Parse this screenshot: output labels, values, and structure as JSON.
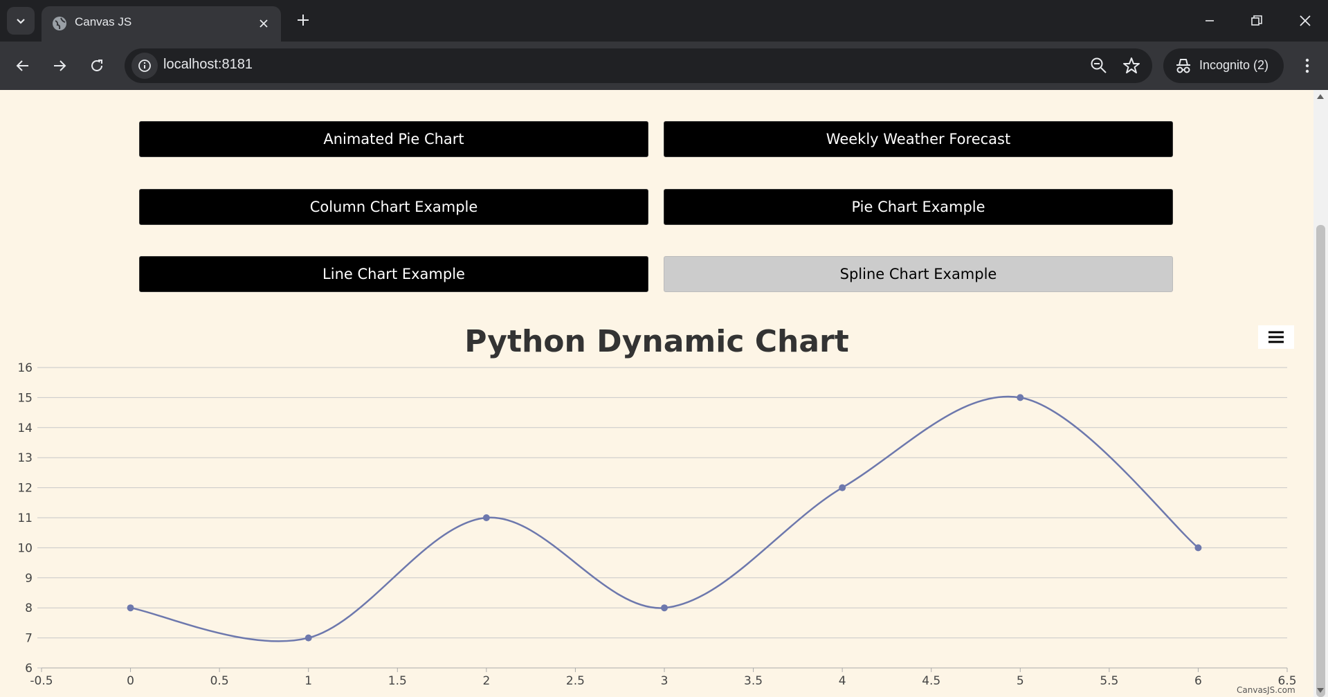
{
  "browser": {
    "tab_title": "Canvas JS",
    "url": "localhost:8181",
    "incognito_label": "Incognito (2)"
  },
  "buttons": [
    {
      "label": "Animated Pie Chart",
      "active": false
    },
    {
      "label": "Weekly Weather Forecast",
      "active": false
    },
    {
      "label": "Column Chart Example",
      "active": false
    },
    {
      "label": "Pie Chart Example",
      "active": false
    },
    {
      "label": "Line Chart Example",
      "active": false
    },
    {
      "label": "Spline Chart Example",
      "active": true
    }
  ],
  "chart_data": {
    "type": "line",
    "title": "Python Dynamic Chart",
    "smoothing": "spline",
    "x": [
      0,
      1,
      2,
      3,
      4,
      5,
      6
    ],
    "series": [
      {
        "values": [
          8,
          7,
          11,
          8,
          12,
          15,
          10
        ],
        "color": "#6d78ad"
      }
    ],
    "xlim": [
      -0.5,
      6.5
    ],
    "ylim": [
      6,
      16
    ],
    "x_ticks": [
      "-0.5",
      "0",
      "0.5",
      "1",
      "1.5",
      "2",
      "2.5",
      "3",
      "3.5",
      "4",
      "4.5",
      "5",
      "5.5",
      "6",
      "6.5"
    ],
    "y_ticks": [
      "6",
      "7",
      "8",
      "9",
      "10",
      "11",
      "12",
      "13",
      "14",
      "15",
      "16"
    ],
    "grid": true,
    "credit": "CanvasJS.com"
  }
}
